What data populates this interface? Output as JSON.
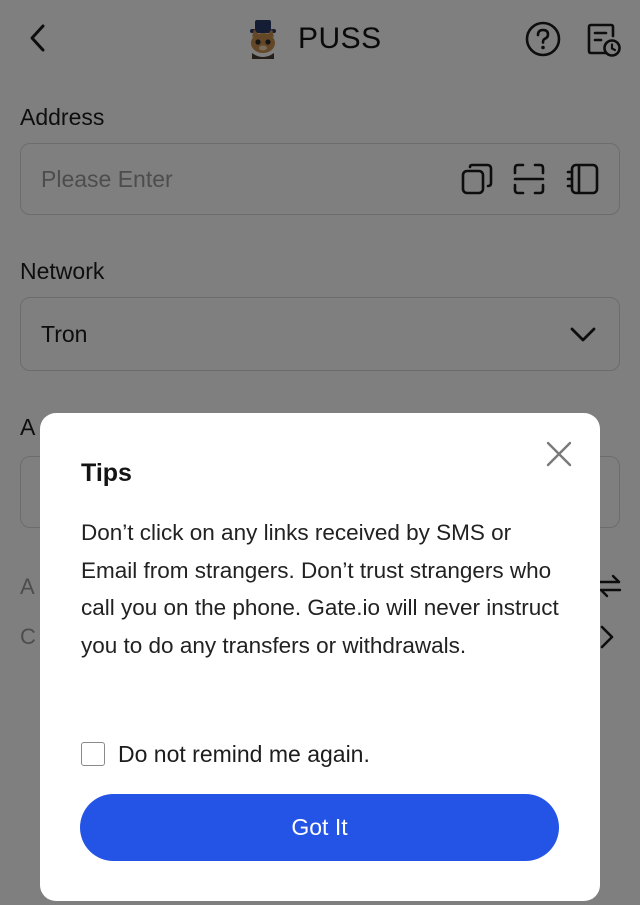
{
  "header": {
    "title": "PUSS",
    "icons": {
      "back": "chevron-left-icon",
      "logo": "puss-token-logo",
      "help": "question-circle-icon",
      "records": "document-clock-icon"
    }
  },
  "form": {
    "address_label": "Address",
    "address_placeholder": "Please Enter",
    "address_icons": [
      "paste-icon",
      "scan-icon",
      "address-book-icon"
    ],
    "network_label": "Network",
    "network_value": "Tron",
    "amount_label_partial": "A",
    "available_partial": "A",
    "contact_partial": "C"
  },
  "modal": {
    "title": "Tips",
    "body": "Don’t click on any links received by SMS or Email from strangers. Don’t trust strangers who call you on the phone. Gate.io will never instruct you to do any transfers or withdrawals.",
    "remind_label": "Do not remind me again.",
    "button_label": "Got It"
  },
  "colors": {
    "primary": "#2354e6",
    "overlay": "rgba(0,0,0,0.5)",
    "text": "#1d1d1d",
    "placeholder": "#9a9a9a"
  }
}
